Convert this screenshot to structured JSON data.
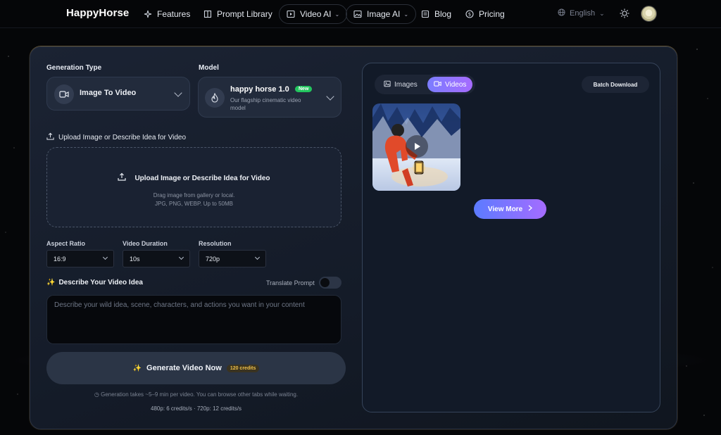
{
  "nav": {
    "brand": "HappyHorse",
    "items": [
      {
        "label": "Features",
        "icon": "sparkles-icon"
      },
      {
        "label": "Prompt Library",
        "icon": "book-icon"
      },
      {
        "label": "Video AI",
        "icon": "video-icon"
      },
      {
        "label": "Image AI",
        "icon": "image-icon"
      },
      {
        "label": "Blog",
        "icon": "blog-icon"
      },
      {
        "label": "Pricing",
        "icon": "dollar-icon"
      }
    ],
    "language": "English"
  },
  "form": {
    "generation_type_label": "Generation Type",
    "generation_type_value": "Image To Video",
    "model_label": "Model",
    "model_name": "happy horse 1.0",
    "model_badge": "New",
    "model_desc_line1": "Our flagship cinematic video",
    "model_desc_line2": "model",
    "upload_label": "Upload Image or Describe Idea for Video",
    "upload_title": "Upload Image or Describe Idea for Video",
    "upload_hint1": "Drag image from gallery or local.",
    "upload_hint2": "JPG, PNG, WEBP. Up to 50MB",
    "aspect_label": "Aspect Ratio",
    "aspect_value": "16:9",
    "duration_label": "Video Duration",
    "duration_value": "10s",
    "resolution_label": "Resolution",
    "resolution_value": "720p",
    "describe_label": "Describe Your Video Idea",
    "translate_label": "Translate Prompt",
    "translate_on": false,
    "prompt_placeholder": "Describe your wild idea, scene, characters, and actions you want in your content",
    "generate_label": "Generate Video Now",
    "credits": "120 credits",
    "note1": "Generation takes ~5–9 min per video. You can browse other tabs while waiting.",
    "note2": "480p: 6 credits/s · 720p: 12 credits/s"
  },
  "panel": {
    "tab_images": "Images",
    "tab_videos": "Videos",
    "active_tab": "Videos",
    "batch_download": "Batch Download",
    "view_more": "View More"
  },
  "colors": {
    "accent_gradient_start": "#7b7dff",
    "accent_gradient_end": "#a66bff",
    "badge_green": "#22c55e",
    "credits_gold": "#f1c24b"
  }
}
